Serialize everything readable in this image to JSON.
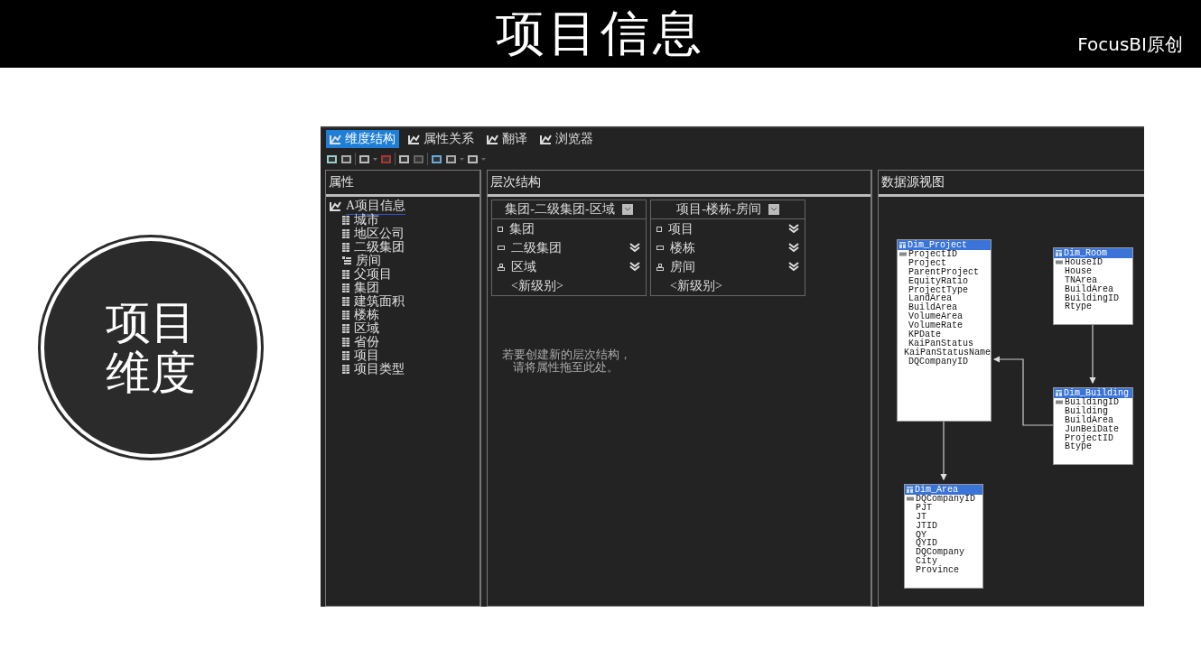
{
  "header": {
    "title": "项目信息",
    "credit": "FocusBI原创"
  },
  "badge": {
    "lines": [
      "项目",
      "维度"
    ]
  },
  "app": {
    "tabs": [
      {
        "label": "维度结构",
        "selected": true
      },
      {
        "label": "属性关系",
        "selected": false
      },
      {
        "label": "翻译",
        "selected": false
      },
      {
        "label": "浏览器",
        "selected": false
      }
    ],
    "attributes": {
      "title": "属性",
      "root": "A项目信息",
      "items": [
        {
          "label": "城市",
          "kind": "attribute"
        },
        {
          "label": "地区公司",
          "kind": "attribute"
        },
        {
          "label": "二级集团",
          "kind": "attribute"
        },
        {
          "label": "房间",
          "kind": "key"
        },
        {
          "label": "父项目",
          "kind": "attribute"
        },
        {
          "label": "集团",
          "kind": "attribute"
        },
        {
          "label": "建筑面积",
          "kind": "attribute"
        },
        {
          "label": "楼栋",
          "kind": "attribute"
        },
        {
          "label": "区域",
          "kind": "attribute"
        },
        {
          "label": "省份",
          "kind": "attribute"
        },
        {
          "label": "项目",
          "kind": "attribute"
        },
        {
          "label": "项目类型",
          "kind": "attribute"
        }
      ]
    },
    "hierarchy": {
      "title": "层次结构",
      "hierarchies": [
        {
          "name": "集团-二级集团-区域",
          "new_level": "<新级别>",
          "levels": [
            {
              "label": "集团",
              "kind": "top",
              "warning": false
            },
            {
              "label": "二级集团",
              "kind": "mid",
              "warning": true
            },
            {
              "label": "区域",
              "kind": "leaf",
              "warning": true
            }
          ]
        },
        {
          "name": "项目-楼栋-房间",
          "new_level": "<新级别>",
          "levels": [
            {
              "label": "项目",
              "kind": "top",
              "warning": true
            },
            {
              "label": "楼栋",
              "kind": "mid",
              "warning": true
            },
            {
              "label": "房间",
              "kind": "leaf",
              "warning": true
            }
          ]
        }
      ],
      "hint": [
        "若要创建新的层次结构，",
        "请将属性拖至此处。"
      ]
    },
    "data_source": {
      "title": "数据源视图",
      "tables": [
        {
          "name": "Dim_Project",
          "columns": [
            {
              "name": "ProjectID",
              "key": true
            },
            {
              "name": "Project",
              "key": false
            },
            {
              "name": "ParentProject",
              "key": false
            },
            {
              "name": "EquityRatio",
              "key": false
            },
            {
              "name": "ProjectType",
              "key": false
            },
            {
              "name": "LandArea",
              "key": false
            },
            {
              "name": "BuildArea",
              "key": false
            },
            {
              "name": "VolumeArea",
              "key": false
            },
            {
              "name": "VolumeRate",
              "key": false
            },
            {
              "name": "KPDate",
              "key": false
            },
            {
              "name": "KaiPanStatus",
              "key": false
            },
            {
              "name": "KaiPanStatusName",
              "key": false
            },
            {
              "name": "DQCompanyID",
              "key": false
            }
          ]
        },
        {
          "name": "Dim_Room",
          "columns": [
            {
              "name": "HouseID",
              "key": true
            },
            {
              "name": "House",
              "key": false
            },
            {
              "name": "TNArea",
              "key": false
            },
            {
              "name": "BuildArea",
              "key": false
            },
            {
              "name": "BuildingID",
              "key": false
            },
            {
              "name": "Rtype",
              "key": false
            }
          ]
        },
        {
          "name": "Dim_Building",
          "columns": [
            {
              "name": "BuildingID",
              "key": true
            },
            {
              "name": "Building",
              "key": false
            },
            {
              "name": "BuildArea",
              "key": false
            },
            {
              "name": "JunBeiDate",
              "key": false
            },
            {
              "name": "ProjectID",
              "key": false
            },
            {
              "name": "Btype",
              "key": false
            }
          ]
        },
        {
          "name": "Dim_Area",
          "columns": [
            {
              "name": "DQCompanyID",
              "key": true
            },
            {
              "name": "PJT",
              "key": false
            },
            {
              "name": "JT",
              "key": false
            },
            {
              "name": "JTID",
              "key": false
            },
            {
              "name": "QY",
              "key": false
            },
            {
              "name": "QYID",
              "key": false
            },
            {
              "name": "DQCompany",
              "key": false
            },
            {
              "name": "City",
              "key": false
            },
            {
              "name": "Province",
              "key": false
            }
          ]
        }
      ]
    }
  }
}
